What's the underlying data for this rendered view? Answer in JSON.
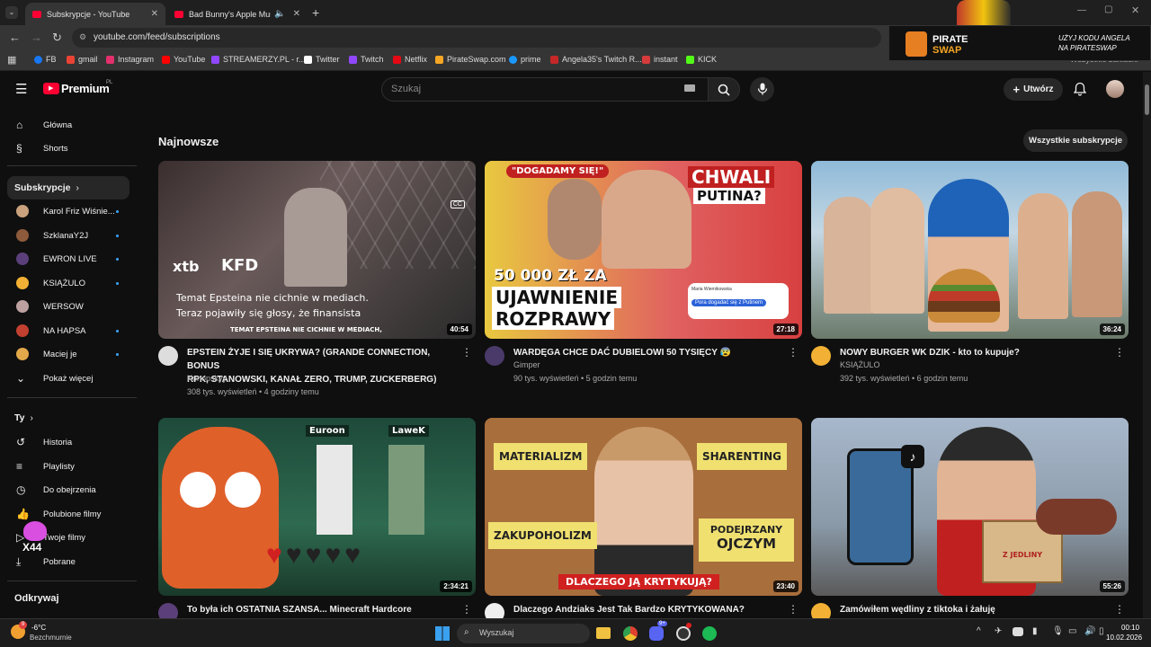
{
  "browser": {
    "tabs": [
      {
        "label": "Subskrypcje - YouTube"
      },
      {
        "label": "Bad Bunny's Apple Music Su"
      }
    ],
    "url": "youtube.com/feed/subscriptions",
    "bookmarks": [
      "FB",
      "gmail",
      "Instagram",
      "YouTube",
      "STREAMERZY.PL - r...",
      "Twitter",
      "Twitch",
      "Netflix",
      "PirateSwap.com",
      "prime",
      "Angela35's Twitch R...",
      "instant",
      "KICK"
    ],
    "bookmark_colors": [
      "#1877f2",
      "#ea4335",
      "#e1306c",
      "#ff0000",
      "#9147ff",
      "#ffffff",
      "#9147ff",
      "#e50914",
      "#f5a623",
      "#1a98ff",
      "#c62828",
      "#d63b3b",
      "#53fc18"
    ],
    "all_bookmarks": "Wszystkie zakładki",
    "ad": {
      "brand_line1": "PIRATE",
      "brand_line2": "SWAP",
      "text_line1": "UŻYJ KODU ANGELA",
      "text_line2": "NA PIRATESWAP"
    }
  },
  "header": {
    "logo": "Premium",
    "region": "PL",
    "search_placeholder": "Szukaj",
    "create_label": "Utwórz"
  },
  "sidebar": {
    "primary": [
      {
        "label": "Główna",
        "icon": "home-icon"
      },
      {
        "label": "Shorts",
        "icon": "shorts-icon"
      }
    ],
    "subscriptions_heading": "Subskrypcje",
    "subscriptions": [
      {
        "label": "Karol Friz Wiśnie...",
        "color": "#c9a27d"
      },
      {
        "label": "SzklanaY2J",
        "color": "#8d5a3b"
      },
      {
        "label": "EWRON LIVE",
        "color": "#5b3f7a"
      },
      {
        "label": "KSIĄŻULO",
        "color": "#f2b134"
      },
      {
        "label": "WERSOW",
        "color": "#bda0a0"
      },
      {
        "label": "NA HAPSA",
        "color": "#c24030"
      },
      {
        "label": "Maciej je",
        "color": "#e2a84a"
      }
    ],
    "show_more": "Pokaż więcej",
    "you_heading": "Ty",
    "you_items": [
      {
        "label": "Historia",
        "icon": "history-icon"
      },
      {
        "label": "Playlisty",
        "icon": "playlist-icon"
      },
      {
        "label": "Do obejrzenia",
        "icon": "watch-later-icon"
      },
      {
        "label": "Polubione filmy",
        "icon": "like-icon"
      },
      {
        "label": "Twoje filmy",
        "icon": "your-videos-icon"
      },
      {
        "label": "Pobrane",
        "icon": "download-icon"
      }
    ],
    "explore_heading": "Odkrywaj"
  },
  "main": {
    "section_title": "Najnowsze",
    "all_subs_button": "Wszystkie subskrypcje",
    "videos": [
      {
        "title_line1": "EPSTEIN ŻYJE I SIĘ UKRYWA? (GRANDE CONNECTION, BONUS",
        "title_line2": "RPK, STANOWSKI, KANAŁ ZERO, TRUMP, ZUCKERBERG)",
        "channel": "Konopskyy",
        "stats": "308 tys. wyświetleń • 4 godziny temu",
        "duration": "40:54",
        "thumb_caption1": "Temat Epsteina nie cichnie w mediach.",
        "thumb_caption2": "Teraz pojawiły się głosy, że finansista",
        "thumb_sub": "TEMAT EPSTEINA NIE CICHNIE W MEDIACH,",
        "thumb_logo1": "xtb",
        "thumb_logo2": "KFD",
        "bg": "#5a4a4a",
        "avatar": "#ddd"
      },
      {
        "title_line1": "WARDĘGA CHCE DAĆ DUBIELOWI 50 TYSIĘCY 😰",
        "title_line2": "",
        "channel": "Gimper",
        "stats": "90 tys. wyświetleń • 5 godzin temu",
        "duration": "27:18",
        "thumb_top": "\"DOGADAMY SIĘ!\"",
        "thumb_right1": "CHWALI",
        "thumb_right2": "PUTINA?",
        "thumb_amount": "50 000 ZŁ ZA",
        "thumb_bottom1": "UJAWNIENIE",
        "thumb_bottom2": "ROZPRAWY",
        "thumb_chat_name": "Maria Wiernikowska",
        "thumb_chat_msg": "Pora dogadać się z Putinem",
        "bg": "#d84a4a",
        "avatar": "#4a3a6a"
      },
      {
        "title_line1": "NOWY BURGER WK DZIK - kto to kupuje?",
        "title_line2": "",
        "channel": "KSIĄŻULO",
        "stats": "392 tys. wyświetleń • 6 godzin temu",
        "duration": "36:24",
        "bg": "#7aa6c8",
        "avatar": "#f2b134"
      },
      {
        "title_line1": "To była ich OSTATNIA SZANSA... Minecraft Hardcore",
        "title_line2": "",
        "channel": "",
        "stats": "",
        "duration": "2:34:21",
        "thumb_name1": "Euroon",
        "thumb_name2": "LaweK",
        "bg": "#2d5a48",
        "avatar": "#5b3f7a"
      },
      {
        "title_line1": "Dlaczego Andziaks Jest Tak Bardzo KRYTYKOWANA?",
        "title_line2": "",
        "channel": "",
        "stats": "",
        "duration": "23:40",
        "thumb_n1": "MATERIALIZM",
        "thumb_n2": "SHARENTING",
        "thumb_n3": "ZAKUPOHOLIZM",
        "thumb_n4a": "PODEJRZANY",
        "thumb_n4b": "OJCZYM",
        "thumb_banner": "DLACZEGO JĄ KRYTYKUJĄ?",
        "bg": "#a06a3a",
        "avatar": "#eee"
      },
      {
        "title_line1": "Zamówiłem wędliny z tiktoka i żałuję",
        "title_line2": "",
        "channel": "",
        "stats": "",
        "duration": "55:26",
        "thumb_box": "Z JEDLINY",
        "bg": "#8aa0b8",
        "avatar": "#f2b134"
      }
    ]
  },
  "taskbar": {
    "weather_temp": "-6°C",
    "weather_desc": "Bezchmurnie",
    "weather_badge": "9",
    "search_placeholder": "Wyszukaj",
    "discord_badge": "9+",
    "time": "00:10",
    "date": "10.02.2026"
  },
  "overlay": {
    "label": "X44"
  }
}
